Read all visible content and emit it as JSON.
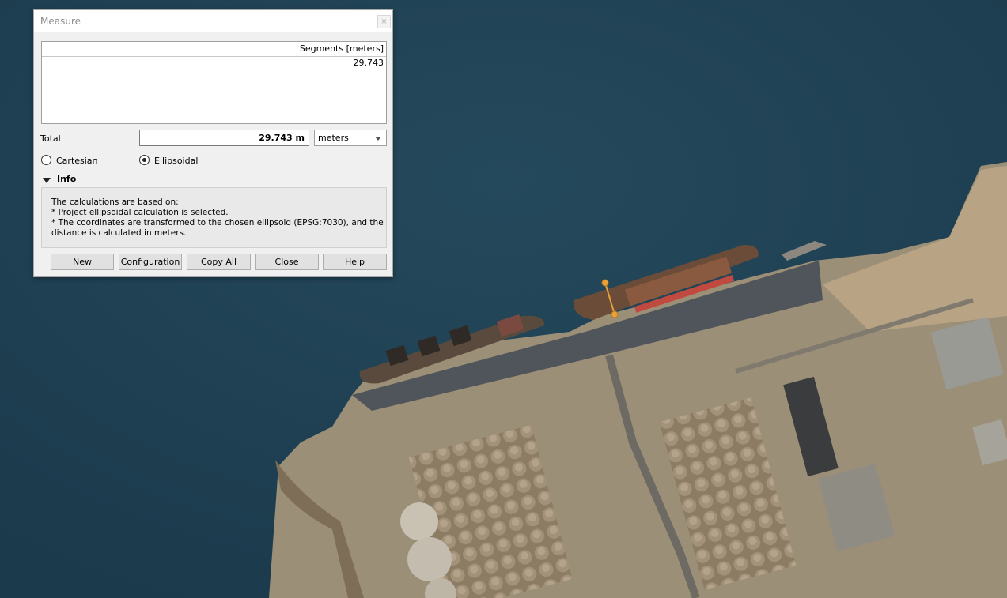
{
  "window": {
    "title": "Measure",
    "close_glyph": "×"
  },
  "segments": {
    "header": "Segments [meters]",
    "rows": [
      "29.743"
    ]
  },
  "total": {
    "label": "Total",
    "value": "29.743 m"
  },
  "units": {
    "selected": "meters"
  },
  "mode": {
    "cartesian_label": "Cartesian",
    "ellipsoidal_label": "Ellipsoidal",
    "selected": "Ellipsoidal"
  },
  "info": {
    "title": "Info",
    "lines": [
      "The calculations are based on:",
      "* Project ellipsoidal calculation is selected.",
      "* The coordinates are transformed to the chosen ellipsoid (EPSG:7030), and the",
      "distance is calculated in meters."
    ]
  },
  "buttons": {
    "new": "New",
    "configuration": "Configuration",
    "copy_all": "Copy All",
    "close": "Close",
    "help": "Help"
  },
  "colors": {
    "water": "#1f3f52",
    "land": "#a89a82",
    "measure_line": "#e8a23a"
  }
}
